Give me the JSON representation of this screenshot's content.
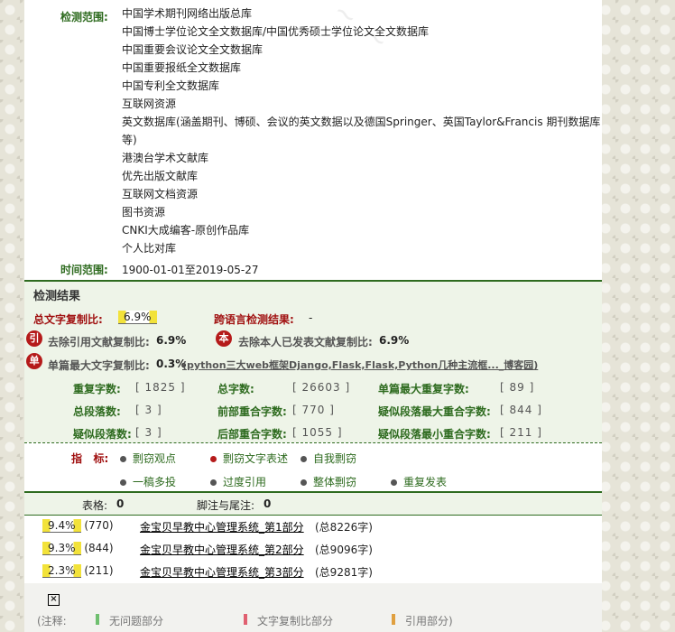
{
  "scope": {
    "label": "检测范围:",
    "items": [
      "中国学术期刊网络出版总库",
      "中国博士学位论文全文数据库/中国优秀硕士学位论文全文数据库",
      "中国重要会议论文全文数据库",
      "中国重要报纸全文数据库",
      "中国专利全文数据库",
      "互联网资源",
      "英文数据库(涵盖期刊、博硕、会议的英文数据以及德国Springer、英国Taylor&Francis 期刊数据库",
      "等)",
      "港澳台学术文献库",
      "优先出版文献库",
      "互联网文档资源",
      "图书资源",
      "CNKI大成编客-原创作品库",
      "个人比对库"
    ]
  },
  "time": {
    "label": "时间范围:",
    "value": "1900-01-01至2019-05-27"
  },
  "result": {
    "header": "检测结果",
    "total_label": "总文字复制比:",
    "total_value": "6.9%",
    "cross_label": "跨语言检测结果:",
    "cross_value": "-",
    "exclude_cite_icon": "引",
    "exclude_cite_label": "去除引用文献复制比:",
    "exclude_cite_value": "6.9%",
    "exclude_self_icon": "本",
    "exclude_self_label": "去除本人已发表文献复制比:",
    "exclude_self_value": "6.9%",
    "single_icon": "单",
    "single_label": "单篇最大文字复制比:",
    "single_value": "0.3%",
    "single_source": "(python三大web框架Django,Flask,Flask,Python几种主流框..._博客园)"
  },
  "stats": [
    {
      "label": "重复字数:",
      "value": "[ 1825 ]"
    },
    {
      "label": "总字数:",
      "value": "[ 26603 ]"
    },
    {
      "label": "单篇最大重复字数:",
      "value": "[ 89 ]"
    },
    {
      "label": "总段落数:",
      "value": "[ 3 ]"
    },
    {
      "label": "前部重合字数:",
      "value": "[ 770 ]"
    },
    {
      "label": "疑似段落最大重合字数:",
      "value": "[ 844 ]"
    },
    {
      "label": "疑似段落数:",
      "value": "[ 3 ]"
    },
    {
      "label": "后部重合字数:",
      "value": "[ 1055 ]"
    },
    {
      "label": "疑似段落最小重合字数:",
      "value": "[ 211 ]"
    }
  ],
  "indicators": {
    "label": "指   标:",
    "items": [
      "剽窃观点",
      "剽窃文字表述",
      "自我剽窃",
      "一稿多投",
      "过度引用",
      "整体剽窃",
      "重复发表"
    ]
  },
  "table_row": {
    "tables_label": "表格:",
    "tables_value": "0",
    "footnotes_label": "脚注与尾注:",
    "footnotes_value": "0"
  },
  "parts": [
    {
      "pct": "9.4%",
      "count": "(770)",
      "title": "金宝贝早教中心管理系统_第1部分",
      "total": "(总8226字)"
    },
    {
      "pct": "9.3%",
      "count": "(844)",
      "title": "金宝贝早教中心管理系统_第2部分",
      "total": "(总9096字)"
    },
    {
      "pct": "2.3%",
      "count": "(211)",
      "title": "金宝贝早教中心管理系统_第3部分",
      "total": "(总9281字)"
    }
  ],
  "legend": {
    "prefix": "(注释:",
    "items": [
      {
        "label": "无问题部分",
        "color": "#6fbf6f"
      },
      {
        "label": "文字复制比部分",
        "color": "#e06070"
      },
      {
        "label": "引用部分)",
        "color": "#e0a040"
      }
    ]
  }
}
